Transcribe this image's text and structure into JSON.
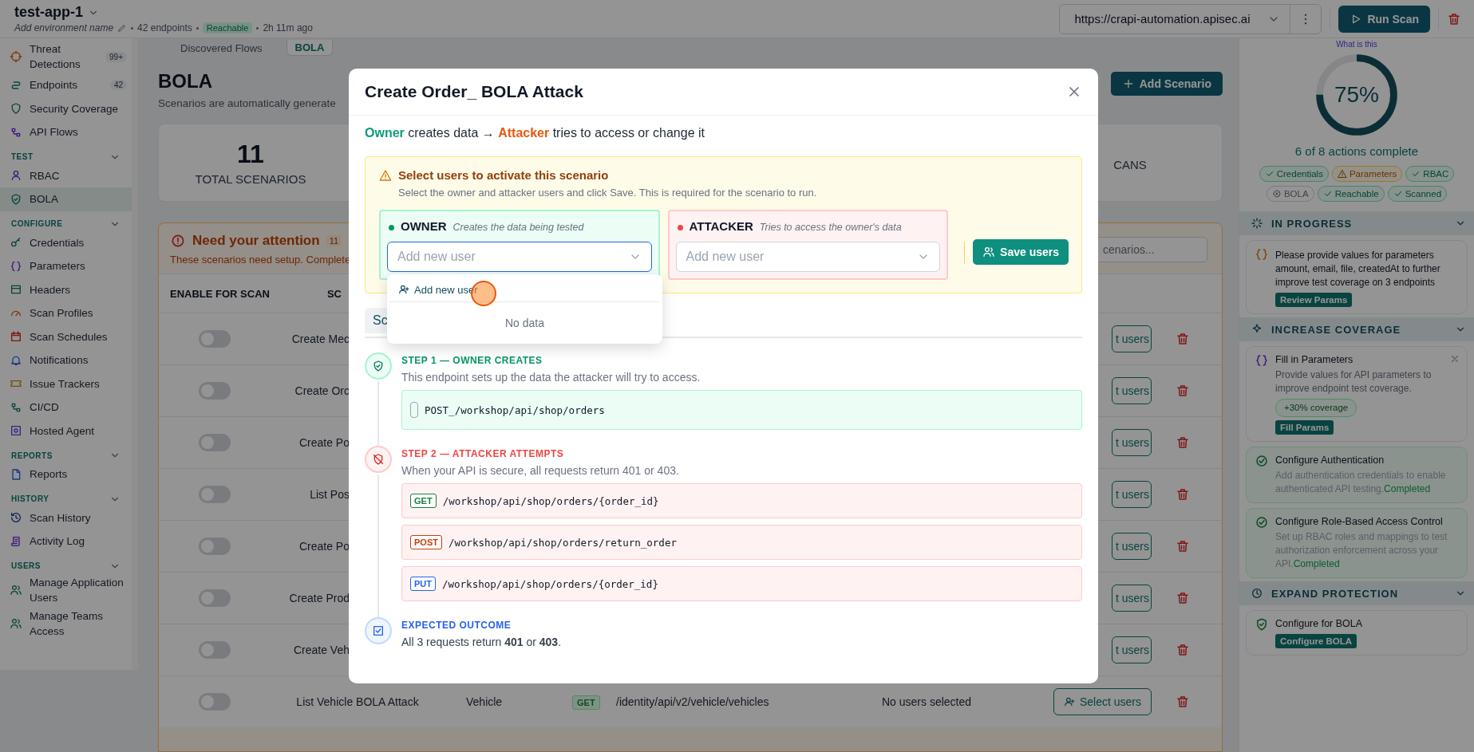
{
  "topbar": {
    "app_name": "test-app-1",
    "env_placeholder": "Add environment name",
    "endpoints": "42 endpoints",
    "status": "Reachable",
    "updated": "2h 11m ago",
    "url": "https://crapi-automation.apisec.ai",
    "run_button": "Run Scan"
  },
  "sidebar": {
    "groups": [
      {
        "items": [
          {
            "label": "Threat Detections",
            "badge": "99+",
            "selected": false
          },
          {
            "label": "Endpoints",
            "badge": "42",
            "selected": false
          },
          {
            "label": "Security Coverage",
            "selected": false
          },
          {
            "label": "API Flows",
            "selected": false
          }
        ]
      },
      {
        "heading": "TEST",
        "expanded": true,
        "items": [
          {
            "label": "RBAC",
            "selected": false
          },
          {
            "label": "BOLA",
            "selected": true
          }
        ]
      },
      {
        "heading": "CONFIGURE",
        "expanded": true,
        "items": [
          {
            "label": "Credentials",
            "selected": false
          },
          {
            "label": "Parameters",
            "selected": false
          },
          {
            "label": "Headers",
            "selected": false
          },
          {
            "label": "Scan Profiles",
            "selected": false
          },
          {
            "label": "Scan Schedules",
            "selected": false
          },
          {
            "label": "Notifications",
            "selected": false
          },
          {
            "label": "Issue Trackers",
            "selected": false
          },
          {
            "label": "CI/CD",
            "selected": false
          },
          {
            "label": "Hosted Agent",
            "selected": false
          }
        ]
      },
      {
        "heading": "REPORTS",
        "expanded": true,
        "items": [
          {
            "label": "Reports",
            "selected": false
          }
        ]
      },
      {
        "heading": "HISTORY",
        "expanded": true,
        "items": [
          {
            "label": "Scan History",
            "selected": false
          },
          {
            "label": "Activity Log",
            "selected": false
          }
        ]
      },
      {
        "heading": "USERS",
        "expanded": true,
        "items": [
          {
            "label": "Manage Application Users",
            "selected": false
          },
          {
            "label": "Manage Teams Access",
            "selected": false
          }
        ]
      }
    ]
  },
  "main": {
    "tabs": [
      {
        "label": "Discovered Flows",
        "selected": false
      },
      {
        "label": "BOLA",
        "selected": true
      }
    ],
    "title": "BOLA",
    "subtitle": "Scenarios are automatically generate",
    "add_button": "Add Scenario",
    "stats": [
      {
        "value": "11",
        "label": "TOTAL SCENARIOS"
      },
      {
        "label": "CANS"
      }
    ],
    "attention": {
      "title": "Need your attention",
      "count": "11",
      "text": "These scenarios need setup. Complete",
      "search_placeholder": "cenarios..."
    },
    "table": {
      "columns": [
        "ENABLE FOR SCAN",
        "SC"
      ],
      "rows": [
        {
          "kind": "partial",
          "enabled": false,
          "name": "Create Mec",
          "action": "t users"
        },
        {
          "kind": "partial",
          "enabled": false,
          "name": "Create Orc",
          "action": "t users"
        },
        {
          "kind": "partial",
          "enabled": false,
          "name": "Create Po",
          "action": "t users"
        },
        {
          "kind": "partial",
          "enabled": false,
          "name": "List Pos",
          "action": "t users"
        },
        {
          "kind": "partial",
          "enabled": false,
          "name": "Create Po",
          "action": "t users"
        },
        {
          "kind": "partial",
          "enabled": false,
          "name": "Create Prod",
          "action": "t users"
        },
        {
          "kind": "partial",
          "enabled": false,
          "name": "Create Veh",
          "action": "t users"
        },
        {
          "kind": "full",
          "enabled": false,
          "name": "List Vehicle BOLA Attack",
          "resource": "Vehicle",
          "method": "GET",
          "path": "/identity/api/v2/vehicle/vehicles",
          "users": "No users selected",
          "action": "Select users"
        }
      ]
    }
  },
  "panel": {
    "link": "What is this",
    "level": 0.75,
    "percent": "75%",
    "summary": "6 of 8 actions complete",
    "chips": [
      {
        "label": "Credentials",
        "kind": "done"
      },
      {
        "label": "Parameters",
        "kind": "warning"
      },
      {
        "label": "RBAC",
        "kind": "done"
      },
      {
        "label": "BOLA",
        "kind": "failed"
      },
      {
        "label": "Reachable",
        "kind": "done"
      },
      {
        "label": "Scanned",
        "kind": "done"
      }
    ],
    "sections": [
      {
        "title": "IN PROGRESS",
        "expanded": true,
        "cards": [
          {
            "kind": "task",
            "text": "Please provide values for parameters amount, email, file, createdAt to further improve test coverage on 3 endpoints",
            "button": "Review Params"
          }
        ]
      },
      {
        "title": "INCREASE COVERAGE",
        "expanded": true,
        "cards": [
          {
            "kind": "suggestion",
            "title": "Fill in Parameters",
            "text": "Provide values for API parameters to improve endpoint test coverage.",
            "tag": "+30% coverage",
            "button": "Fill Params"
          },
          {
            "kind": "completed",
            "title": "Configure Authentication",
            "text": "Add authentication credentials to enable authenticated API testing.",
            "status": "Completed"
          },
          {
            "kind": "completed",
            "title": "Configure Role-Based Access Control",
            "text": "Set up RBAC roles and mappings to test authorization enforcement across your API.",
            "status": "Completed"
          }
        ]
      },
      {
        "title": "EXPAND PROTECTION",
        "expanded": true,
        "cards": [
          {
            "kind": "action",
            "title": "Configure for BOLA",
            "button": "Configure BOLA"
          }
        ]
      }
    ]
  },
  "modal": {
    "title": "Create Order_ BOLA Attack",
    "flow": {
      "owner": "Owner",
      "middle": "creates data →",
      "attacker": "Attacker",
      "rest": "tries to access or change it"
    },
    "notice": {
      "title": "Select users to activate this scenario",
      "text": "Select the owner and attacker users and click Save. This is required for the scenario to run."
    },
    "roles": [
      {
        "kind": "owner",
        "label": "OWNER",
        "hint": "Creates the data being tested",
        "placeholder": "Add new user",
        "focused": true
      },
      {
        "kind": "attacker",
        "label": "ATTACKER",
        "hint": "Tries to access the owner's data",
        "placeholder": "Add new user",
        "focused": false
      }
    ],
    "save_button": "Save users",
    "dropdown": {
      "action": "Add new user",
      "empty": "No data"
    },
    "tabs": [
      {
        "label": "Sc",
        "selected": true
      }
    ],
    "steps": [
      {
        "kind": "owner",
        "title": "STEP 1 — OWNER CREATES",
        "text": "This endpoint sets up the data the attacker will try to access.",
        "endpoints": [
          {
            "path": "POST_/workshop/api/shop/orders"
          }
        ]
      },
      {
        "kind": "attacker",
        "title": "STEP 2 — ATTACKER ATTEMPTS",
        "text": "When your API is secure, all requests return 401 or 403.",
        "endpoints": [
          {
            "method": "GET",
            "color": "#15803d",
            "path": "/workshop/api/shop/orders/{order_id}"
          },
          {
            "method": "POST",
            "color": "#c2410c",
            "path": "/workshop/api/shop/orders/return_order"
          },
          {
            "method": "PUT",
            "color": "#2563eb",
            "path": "/workshop/api/shop/orders/{order_id}"
          }
        ]
      },
      {
        "kind": "outcome",
        "title": "EXPECTED OUTCOME",
        "text": "All 3 requests return **401** or **403**."
      }
    ]
  }
}
